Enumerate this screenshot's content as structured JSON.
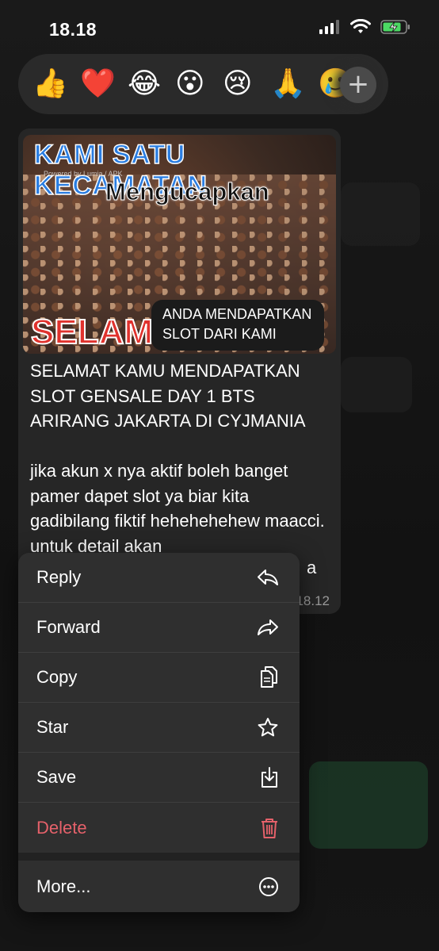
{
  "status_bar": {
    "time": "18.18"
  },
  "reactions": {
    "emojis": [
      {
        "icon": "thumbs-up-icon",
        "glyph": "👍"
      },
      {
        "icon": "red-heart-icon",
        "glyph": "❤️"
      },
      {
        "icon": "tears-of-joy-icon",
        "glyph": "😂"
      },
      {
        "icon": "surprised-face-icon",
        "glyph": "😮"
      },
      {
        "icon": "crying-face-icon",
        "glyph": "😢"
      },
      {
        "icon": "folded-hands-icon",
        "glyph": "🙏"
      },
      {
        "icon": "partial-emoji-icon",
        "glyph": "🥲"
      }
    ],
    "more_glyph": "+"
  },
  "message": {
    "image": {
      "banner": "KAMI SATU KECAMATAN",
      "powered": "Powered by Lumia / APK",
      "subtitle": "Mengucapkan",
      "selamat": "SELAMAT",
      "badge_line1": "ANDA MENDAPATKAN",
      "badge_line2": "SLOT DARI KAMI"
    },
    "paragraph1": "SELAMAT KAMU MENDAPATKAN SLOT GENSALE DAY 1 BTS ARIRANG JAKARTA DI CYJMANIA",
    "paragraph2": "jika akun x nya aktif boleh banget pamer dapet slot ya biar kita gadibilang fiktif hehehehehew maacci. untuk detail akan",
    "paragraph2_tail": "a",
    "time": "18.12"
  },
  "menu": {
    "reply": "Reply",
    "forward": "Forward",
    "copy": "Copy",
    "star": "Star",
    "save": "Save",
    "delete": "Delete",
    "more": "More...",
    "delete_color": "#e5616a"
  }
}
